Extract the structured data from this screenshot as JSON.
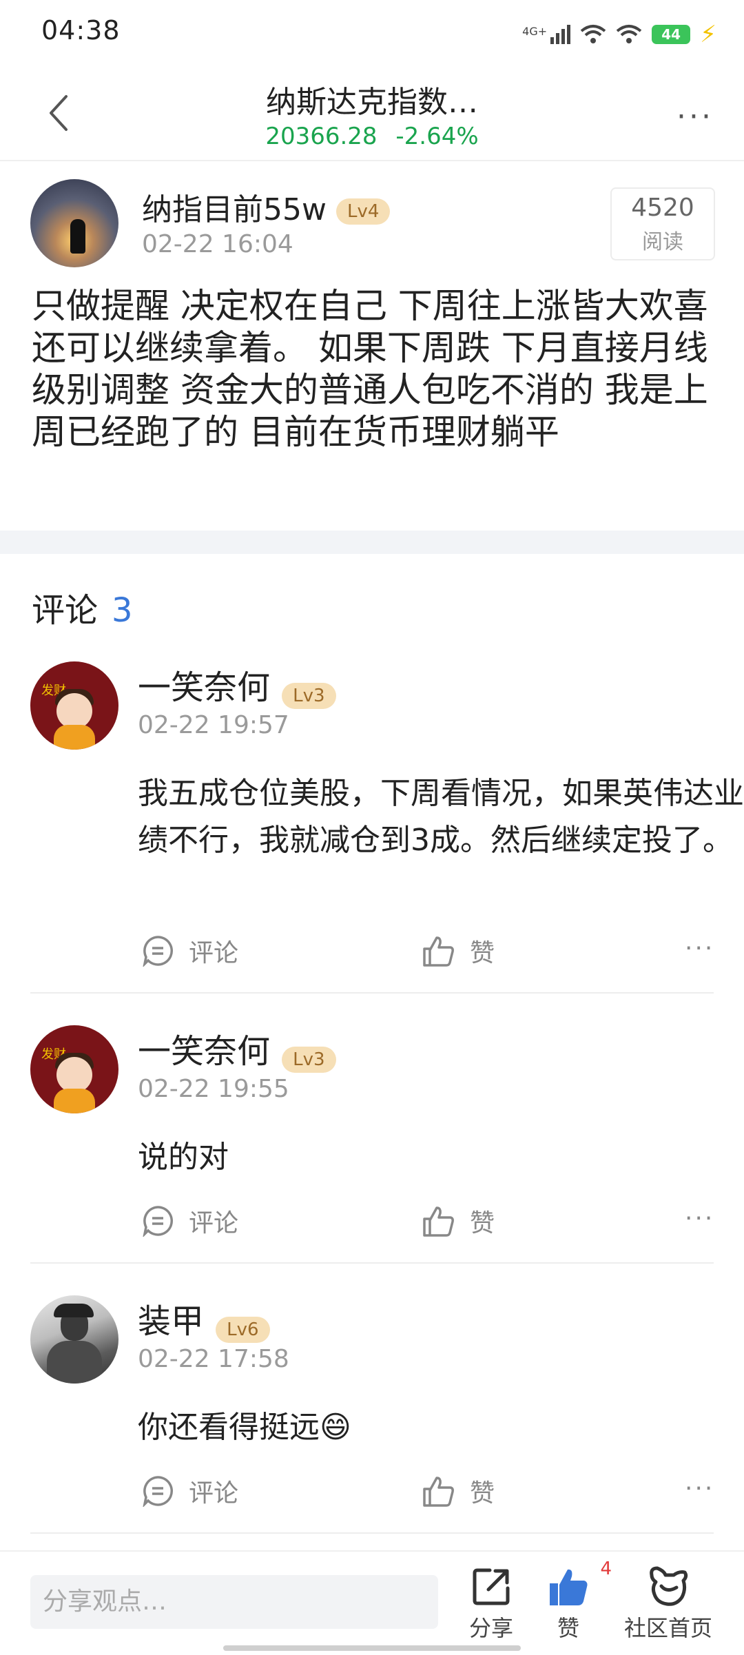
{
  "status_bar": {
    "time": "04:38",
    "network": "4G+",
    "battery": "44"
  },
  "nav": {
    "title": "纳斯达克指数…",
    "price": "20366.28",
    "change": "-2.64%",
    "price_color": "#1aa44e"
  },
  "post": {
    "author": "纳指目前55w",
    "level": "Lv4",
    "date": "02-22 16:04",
    "views": "4520",
    "views_label": "阅读",
    "text": "只做提醒 决定权在自己 下周往上涨皆大欢喜 还可以继续拿着。 如果下周跌 下月直接月线级别调整 资金大的普通人包吃不消的 我是上周已经跑了的 目前在货币理财躺平"
  },
  "comments_header": {
    "label": "评论",
    "count": "3",
    "count_color": "#3a78d8"
  },
  "comments": [
    {
      "name": "一笑奈何",
      "level": "Lv3",
      "date": "02-22 19:57",
      "text": "我五成仓位美股，下周看情况，如果英伟达业绩不行，我就减仓到3成。然后继续定投了。",
      "reply_label": "评论",
      "like_label": "赞",
      "avatar_text": "发财"
    },
    {
      "name": "一笑奈何",
      "level": "Lv3",
      "date": "02-22 19:55",
      "text": "说的对",
      "reply_label": "评论",
      "like_label": "赞",
      "avatar_text": "发财"
    },
    {
      "name": "装甲",
      "level": "Lv6",
      "date": "02-22 17:58",
      "text": "你还看得挺远😄",
      "reply_label": "评论",
      "like_label": "赞"
    }
  ],
  "bottom_bar": {
    "input_placeholder": "分享观点…",
    "share_label": "分享",
    "like_label": "赞",
    "like_count": "4",
    "community_label": "社区首页"
  }
}
